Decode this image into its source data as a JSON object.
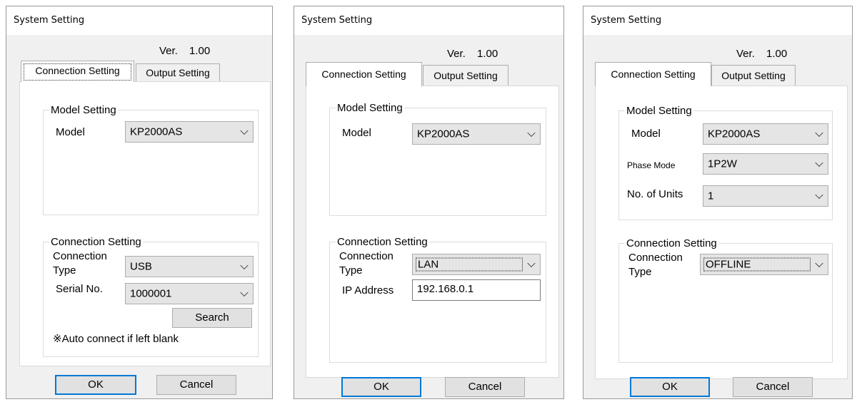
{
  "dialogs": [
    {
      "title": "System Setting",
      "version_label": "Ver.",
      "version_value": "1.00",
      "tabs": [
        "Connection Setting",
        "Output Setting"
      ],
      "model_group": "Model Setting",
      "model_label": "Model",
      "model_value": "KP2000AS",
      "connection_group": "Connection Setting",
      "connection_type_label_1": "Connection",
      "connection_type_label_2": "Type",
      "connection_type_value": "USB",
      "serial_label": "Serial No.",
      "serial_value": "1000001",
      "search_label": "Search",
      "note": "※Auto connect if left blank",
      "ok_label": "OK",
      "cancel_label": "Cancel"
    },
    {
      "title": "System Setting",
      "version_label": "Ver.",
      "version_value": "1.00",
      "tabs": [
        "Connection Setting",
        "Output Setting"
      ],
      "model_group": "Model Setting",
      "model_label": "Model",
      "model_value": "KP2000AS",
      "connection_group": "Connection Setting",
      "connection_type_label_1": "Connection",
      "connection_type_label_2": "Type",
      "connection_type_value": "LAN",
      "ip_label": "IP Address",
      "ip_value": "192.168.0.1",
      "ok_label": "OK",
      "cancel_label": "Cancel"
    },
    {
      "title": "System Setting",
      "version_label": "Ver.",
      "version_value": "1.00",
      "tabs": [
        "Connection Setting",
        "Output Setting"
      ],
      "model_group": "Model Setting",
      "model_label": "Model",
      "model_value": "KP2000AS",
      "phase_label": "Phase Mode",
      "phase_value": "1P2W",
      "units_label": "No. of Units",
      "units_value": "1",
      "connection_group": "Connection Setting",
      "connection_type_label_1": "Connection",
      "connection_type_label_2": "Type",
      "connection_type_value": "OFFLINE",
      "ok_label": "OK",
      "cancel_label": "Cancel"
    }
  ]
}
